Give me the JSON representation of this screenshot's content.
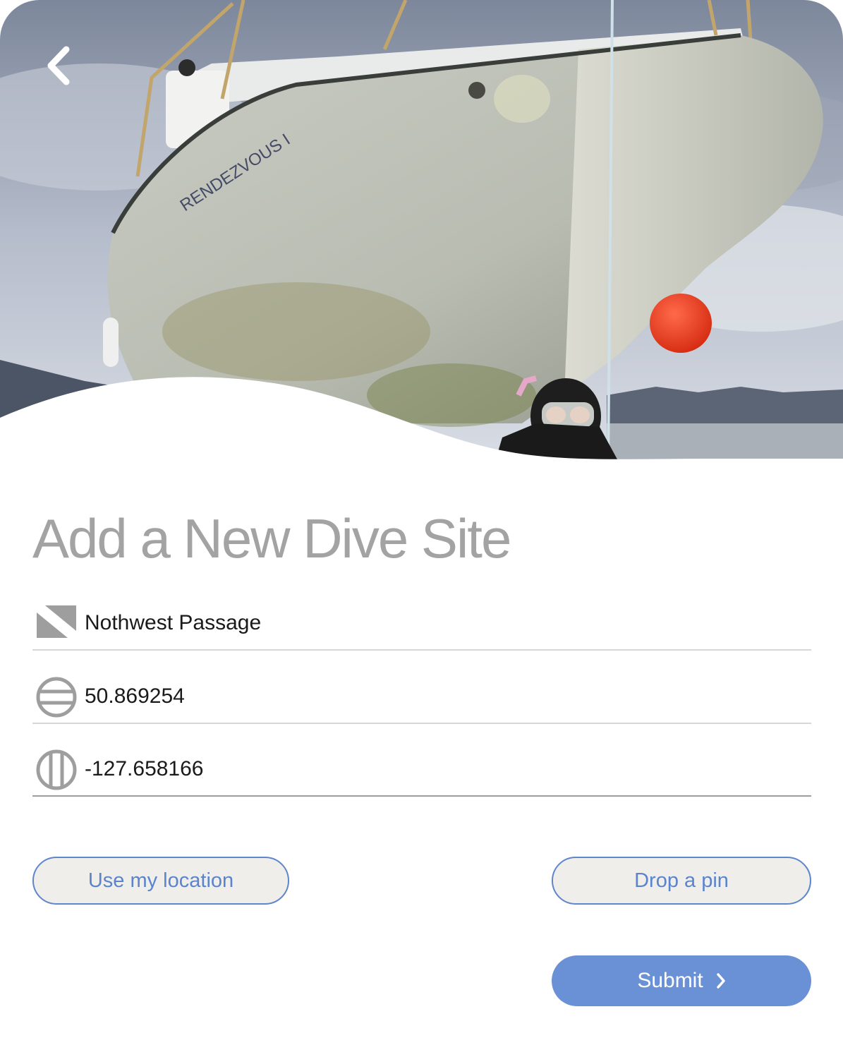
{
  "header": {
    "back_icon": "chevron-left-icon",
    "hero_image": "dive-boat-photo"
  },
  "form": {
    "title": "Add a New Dive Site",
    "site_name": {
      "icon": "dive-flag-icon",
      "value": "Nothwest Passage"
    },
    "latitude": {
      "icon": "latitude-globe-icon",
      "value": "50.869254"
    },
    "longitude": {
      "icon": "longitude-globe-icon",
      "value": "-127.658166"
    }
  },
  "actions": {
    "use_location_label": "Use my location",
    "drop_pin_label": "Drop a pin",
    "submit_label": "Submit",
    "submit_icon": "chevron-right-icon"
  },
  "colors": {
    "accent": "#6a91d6",
    "pill_border": "#5f86cc",
    "pill_background": "#efeeeb",
    "title": "#a3a3a3",
    "icon_gray": "#9e9e9e"
  }
}
